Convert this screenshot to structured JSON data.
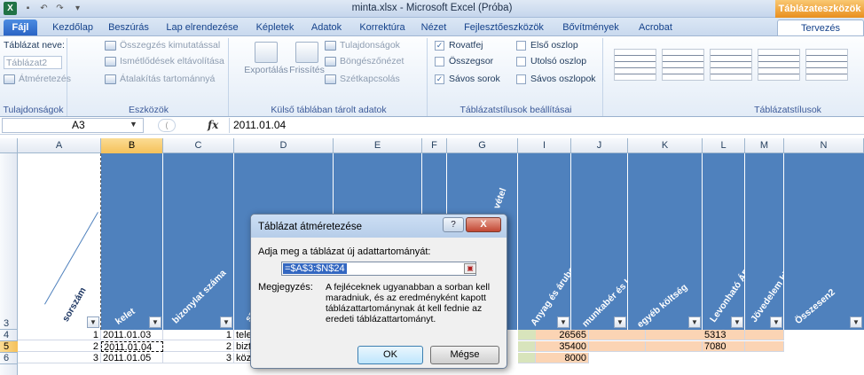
{
  "window": {
    "title": "minta.xlsx - Microsoft Excel (Próba)",
    "context_tab_group": "Táblázateszközök"
  },
  "tabs": [
    "Fájl",
    "Kezdőlap",
    "Beszúrás",
    "Lap elrendezése",
    "Képletek",
    "Adatok",
    "Korrektúra",
    "Nézet",
    "Fejlesztőeszközök",
    "Bővítmények",
    "Acrobat",
    "Tervezés"
  ],
  "ribbon": {
    "properties": {
      "name_label": "Táblázat neve:",
      "name_value": "Táblázat2",
      "resize": "Átméretezés",
      "group": "Tulajdonságok"
    },
    "tools": {
      "pivot": "Összegzés kimutatással",
      "remove_dups": "Ismétlődések eltávolítása",
      "convert": "Átalakítás tartománnyá",
      "group": "Eszközök"
    },
    "external": {
      "export": "Exportálás",
      "refresh": "Frissítés",
      "properties": "Tulajdonságok",
      "browser": "Böngészőnézet",
      "unlink": "Szétkapcsolás",
      "group": "Külső táblában tárolt adatok"
    },
    "style_options": {
      "header_row": "Rovatfej",
      "total_row": "Összegsor",
      "banded_rows": "Sávos sorok",
      "first_col": "Első oszlop",
      "last_col": "Utolsó oszlop",
      "banded_cols": "Sávos oszlopok",
      "group": "Táblázatstílusok beállításai"
    },
    "styles_group": "Táblázatstílusok"
  },
  "formula_bar": {
    "name_box": "A3",
    "fx": "fx",
    "value": "2011.01.04"
  },
  "columns": [
    "A",
    "B",
    "C",
    "D",
    "E",
    "F",
    "G",
    "I",
    "J",
    "K",
    "L",
    "M",
    "N"
  ],
  "rows": [
    "3",
    "4",
    "5",
    "6"
  ],
  "header_labels": [
    "sorszám",
    "kelet",
    "bizonylat száma",
    "sz",
    "",
    "",
    "vétel",
    "FA",
    "Anyag és árubeszerzés",
    "munkabér és közteher",
    "egyéb költség",
    "Levonható ÁFA",
    "Jövedelem kivét",
    "Összesen2"
  ],
  "table_rows": [
    {
      "a": "1",
      "b": "2011.01.03",
      "c": "1",
      "d": "telefo",
      "i": "26565",
      "l": "5313"
    },
    {
      "a": "2",
      "b": "2011.01.04",
      "c": "2",
      "d": "biztos",
      "i": "35400",
      "l": "7080"
    },
    {
      "a": "3",
      "b": "2011.01.05",
      "c": "3",
      "d": "közö",
      "i": "8000",
      "l": ""
    }
  ],
  "dialog": {
    "title": "Táblázat átméretezése",
    "help": "?",
    "close": "X",
    "prompt": "Adja meg a táblázat új adattartományát:",
    "range": "=$A$3:$N$24",
    "note_label": "Megjegyzés:",
    "note_text": "A fejléceknek ugyanabban a sorban kell maradniuk, és az eredményként kapott táblázattartománynak át kell fednie az eredeti táblázattartományt.",
    "ok": "OK",
    "cancel": "Mégse"
  },
  "colors": {
    "header_fill": "#4f81bd",
    "orange_fill": "#fbd4b4",
    "green_fill": "#d8e4bc",
    "selection": "#f5c15a"
  }
}
